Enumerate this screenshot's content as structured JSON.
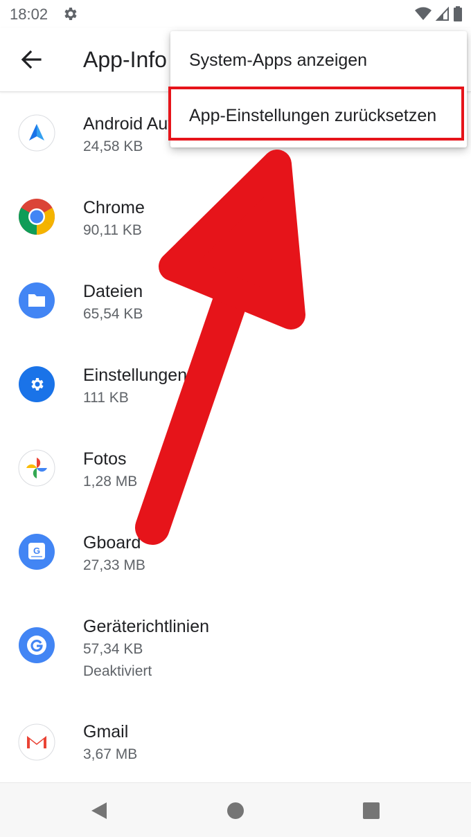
{
  "status_bar": {
    "time": "18:02",
    "icons": [
      "settings-gear-icon",
      "wifi-icon",
      "cellular-signal-icon",
      "battery-icon"
    ]
  },
  "app_bar": {
    "back_icon": "arrow-back-icon",
    "title": "App-Info"
  },
  "overflow_menu": {
    "items": [
      {
        "label": "System-Apps anzeigen"
      },
      {
        "label": "App-Einstellungen zurücksetzen",
        "highlighted": true
      }
    ]
  },
  "apps": [
    {
      "name": "Android Auto",
      "size": "24,58 KB",
      "icon": "android-auto-icon"
    },
    {
      "name": "Chrome",
      "size": "90,11 KB",
      "icon": "chrome-icon"
    },
    {
      "name": "Dateien",
      "size": "65,54 KB",
      "icon": "files-folder-icon"
    },
    {
      "name": "Einstellungen",
      "size": "111 KB",
      "icon": "settings-icon"
    },
    {
      "name": "Fotos",
      "size": "1,28 MB",
      "icon": "photos-pinwheel-icon"
    },
    {
      "name": "Gboard",
      "size": "27,33 MB",
      "icon": "gboard-keyboard-icon"
    },
    {
      "name": "Geräterichtlinien",
      "size": "57,34 KB",
      "status": "Deaktiviert",
      "icon": "device-policy-g-icon"
    },
    {
      "name": "Gmail",
      "size": "3,67 MB",
      "icon": "gmail-icon"
    }
  ],
  "nav_bar": {
    "icons": [
      "nav-back-icon",
      "nav-home-icon",
      "nav-recents-icon"
    ]
  },
  "colors": {
    "annotation_red": "#e6141a",
    "text_primary": "#202124",
    "text_secondary": "#5f6368"
  }
}
